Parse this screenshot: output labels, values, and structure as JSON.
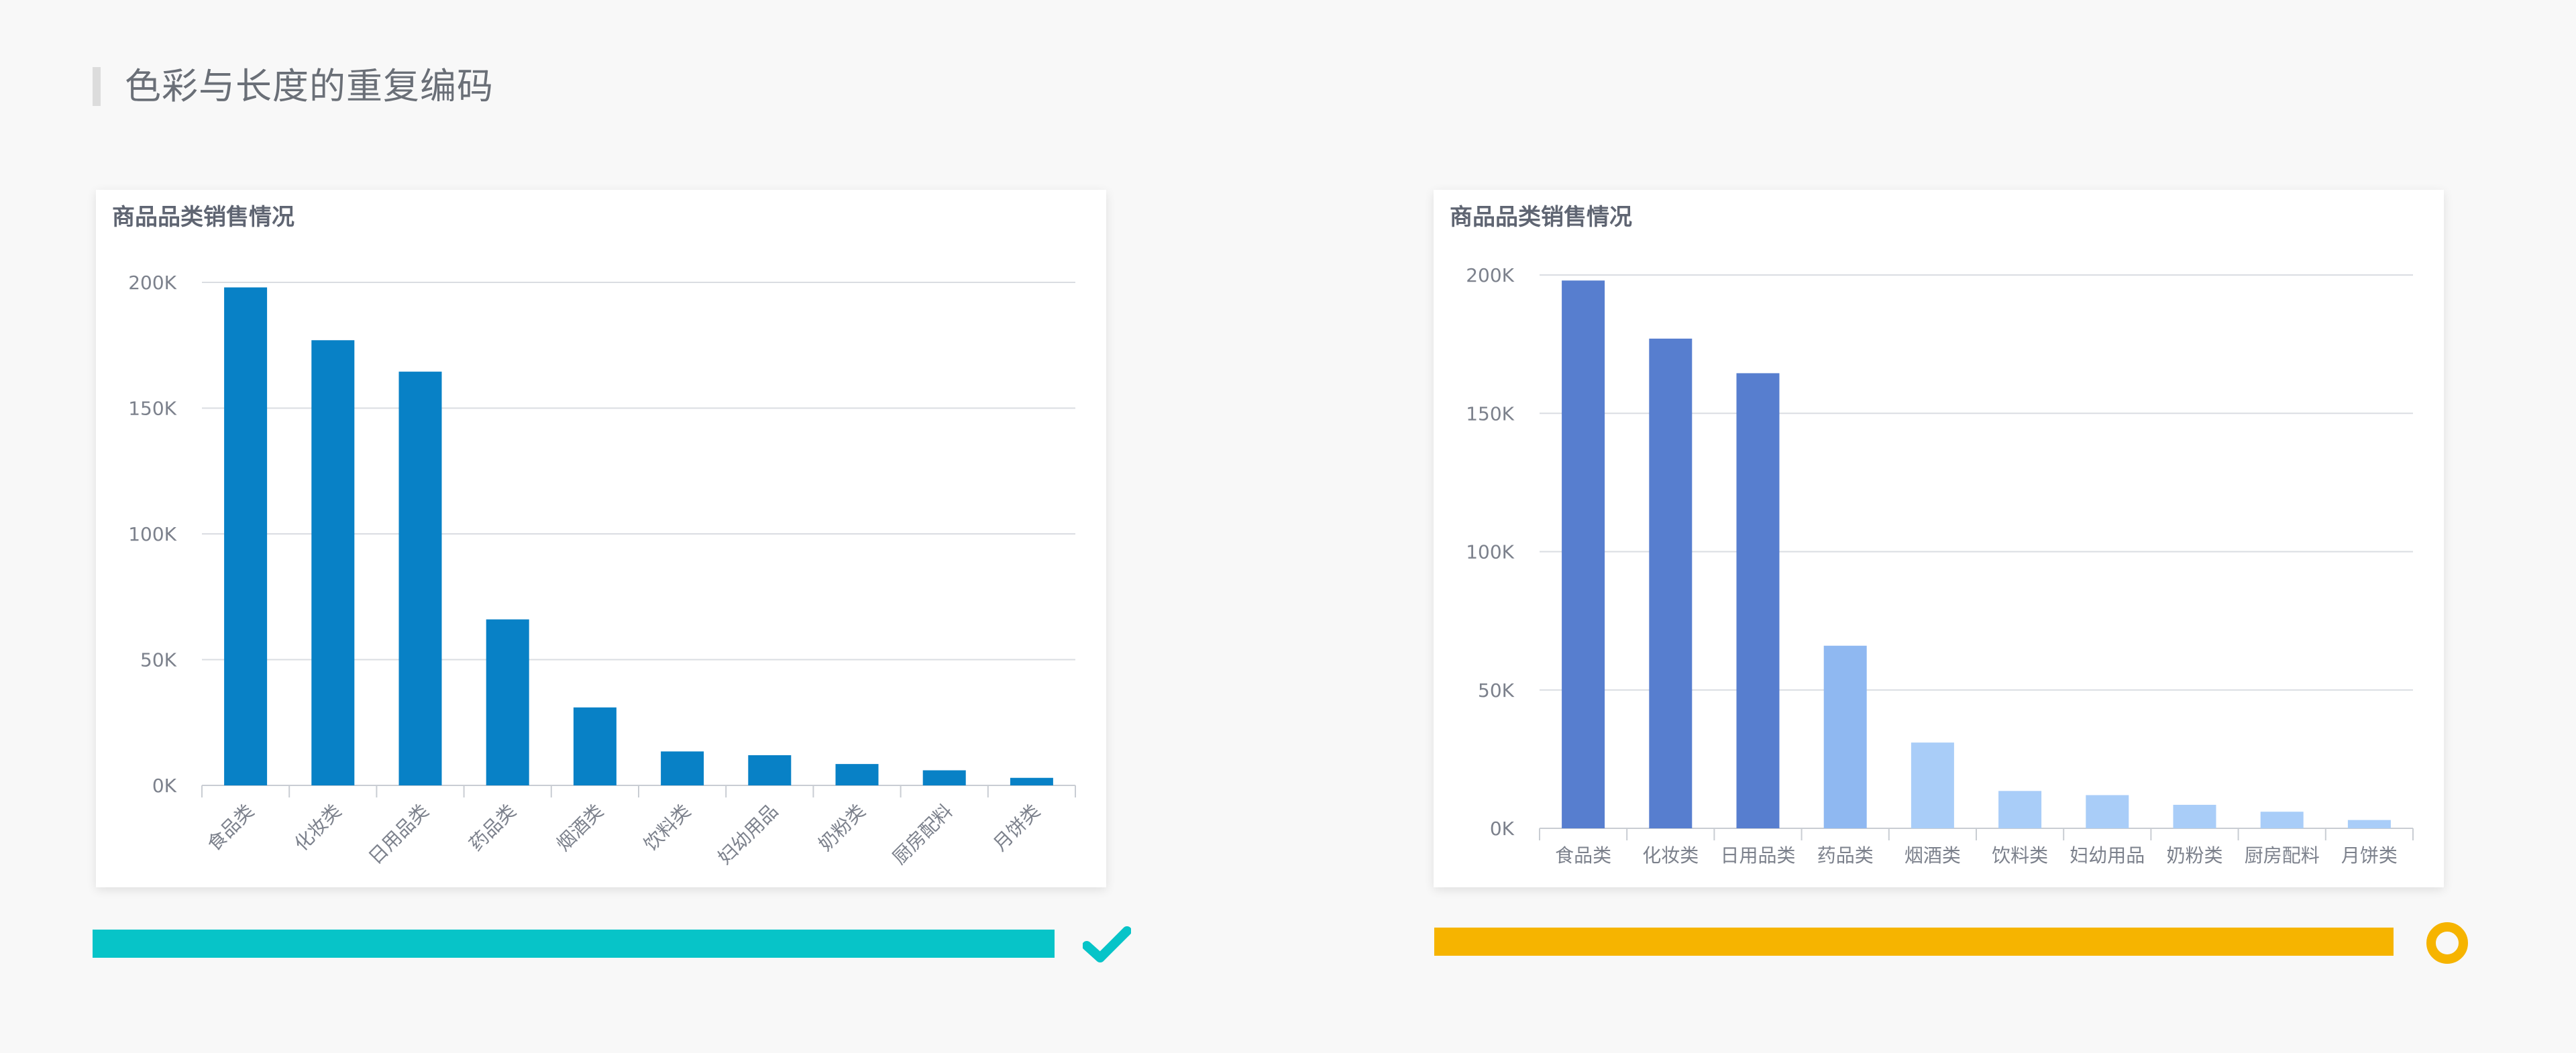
{
  "page": {
    "title": "色彩与长度的重复编码"
  },
  "colors": {
    "background": "#f8f8f8",
    "card": "#ffffff",
    "title_accent": "#dcdcdc",
    "left_bar": "#0881c6",
    "right_bar_strong": "#577ecf",
    "right_bar_mid": "#8fb8f1",
    "right_bar_light": "#a9cdf8",
    "good_bar": "#07c4c8",
    "warn_bar": "#f6b400",
    "grid": "#dadde2",
    "axis_text": "#7c818c"
  },
  "icons": {
    "left_status": "check-icon",
    "right_status": "ring-icon"
  },
  "chart_data": [
    {
      "type": "bar",
      "title": "商品品类销售情况",
      "categories": [
        "食品类",
        "化妆类",
        "日用品类",
        "药品类",
        "烟酒类",
        "饮料类",
        "妇幼用品",
        "奶粉类",
        "厨房配料",
        "月饼类"
      ],
      "values": [
        198000,
        177000,
        164500,
        66000,
        31000,
        13500,
        12000,
        8500,
        6000,
        3000
      ],
      "y_ticks": [
        "0K",
        "50K",
        "100K",
        "150K",
        "200K"
      ],
      "ylim": [
        0,
        200000
      ],
      "xlabel": "",
      "ylabel": "",
      "grid": true,
      "x_label_rotation": -45,
      "bar_colors": [
        "#0881c6",
        "#0881c6",
        "#0881c6",
        "#0881c6",
        "#0881c6",
        "#0881c6",
        "#0881c6",
        "#0881c6",
        "#0881c6",
        "#0881c6"
      ]
    },
    {
      "type": "bar",
      "title": "商品品类销售情况",
      "categories": [
        "食品类",
        "化妆类",
        "日用品类",
        "药品类",
        "烟酒类",
        "饮料类",
        "妇幼用品",
        "奶粉类",
        "厨房配料",
        "月饼类"
      ],
      "values": [
        198000,
        177000,
        164500,
        66000,
        31000,
        13500,
        12000,
        8500,
        6000,
        3000
      ],
      "y_ticks": [
        "0K",
        "50K",
        "100K",
        "150K",
        "200K"
      ],
      "ylim": [
        0,
        200000
      ],
      "xlabel": "",
      "ylabel": "",
      "grid": true,
      "x_label_rotation": 0,
      "bar_colors": [
        "#577ecf",
        "#577ecf",
        "#577ecf",
        "#8fb8f1",
        "#a9cdf8",
        "#a9cdf8",
        "#a9cdf8",
        "#a9cdf8",
        "#a9cdf8",
        "#a9cdf8"
      ]
    }
  ]
}
